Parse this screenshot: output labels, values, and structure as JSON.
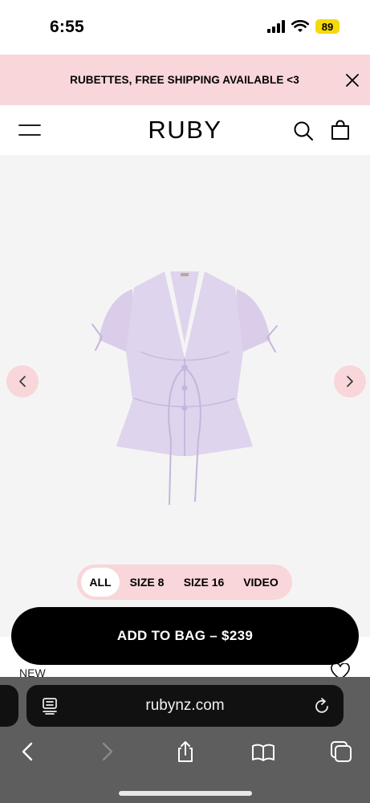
{
  "status_bar": {
    "time": "6:55",
    "battery": "89"
  },
  "promo": {
    "text": "RUBETTES, FREE SHIPPING AVAILABLE <3"
  },
  "header": {
    "brand": "RUBY"
  },
  "gallery": {
    "filters": [
      {
        "label": "ALL",
        "active": true
      },
      {
        "label": "SIZE 8",
        "active": false
      },
      {
        "label": "SIZE 16",
        "active": false
      },
      {
        "label": "VIDEO",
        "active": false
      }
    ],
    "product_color": "#d9cdea"
  },
  "cta": {
    "add_to_bag": "ADD TO BAG – $239"
  },
  "product": {
    "tag": "NEW"
  },
  "browser": {
    "url": "rubynz.com"
  },
  "colors": {
    "promo_bg": "#f8d6d9",
    "gallery_bg": "#f5f4f4",
    "button_bg": "#000000",
    "browser_bg": "#5e5e5e"
  }
}
